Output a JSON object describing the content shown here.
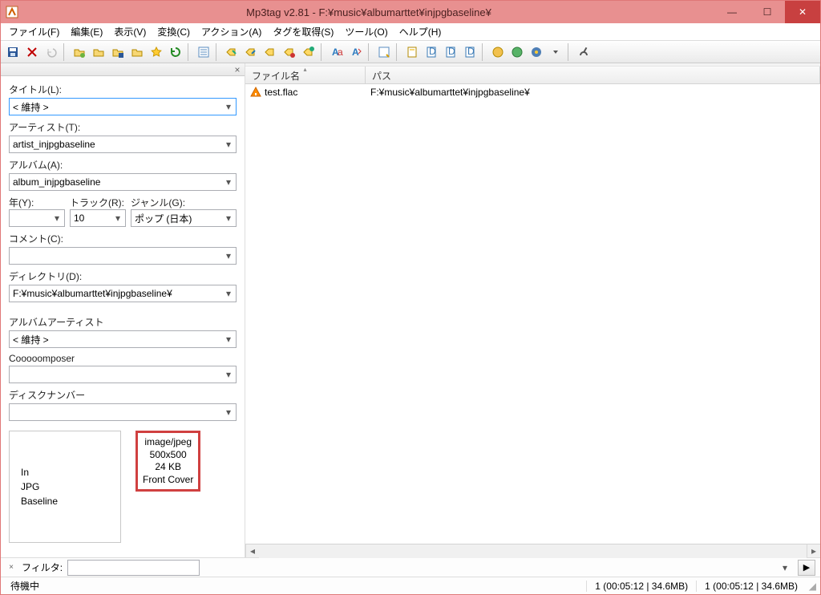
{
  "title": "Mp3tag v2.81  -  F:¥music¥albumarttet¥injpgbaseline¥",
  "menu": [
    "ファイル(F)",
    "編集(E)",
    "表示(V)",
    "変換(C)",
    "アクション(A)",
    "タグを取得(S)",
    "ツール(O)",
    "ヘルプ(H)"
  ],
  "panel": {
    "title_label": "タイトル(L):",
    "title_value": "< 維持 >",
    "artist_label": "アーティスト(T):",
    "artist_value": "artist_injpgbaseline",
    "album_label": "アルバム(A):",
    "album_value": "album_injpgbaseline",
    "year_label": "年(Y):",
    "year_value": "",
    "track_label": "トラック(R):",
    "track_value": "10",
    "genre_label": "ジャンル(G):",
    "genre_value": "ポップ (日本)",
    "comment_label": "コメント(C):",
    "comment_value": "",
    "directory_label": "ディレクトリ(D):",
    "directory_value": "F:¥music¥albumarttet¥injpgbaseline¥",
    "albumartist_label": "アルバムアーティスト",
    "albumartist_value": "< 維持 >",
    "composer_label": "Cooooomposer",
    "composer_value": "",
    "discnumber_label": "ディスクナンバー",
    "discnumber_value": ""
  },
  "cover": {
    "line1": "In",
    "line2": "JPG",
    "line3": "Baseline",
    "info1": "image/jpeg",
    "info2": "500x500",
    "info3": "24 KB",
    "info4": "Front Cover"
  },
  "list": {
    "col_name": "ファイル名",
    "col_path": "パス",
    "rows": [
      {
        "name": "test.flac",
        "path": "F:¥music¥albumarttet¥injpgbaseline¥"
      }
    ]
  },
  "filter": {
    "label": "フィルタ:",
    "value": ""
  },
  "status": {
    "ready": "待機中",
    "seg1": "1 (00:05:12 | 34.6MB)",
    "seg2": "1 (00:05:12 | 34.6MB)"
  }
}
